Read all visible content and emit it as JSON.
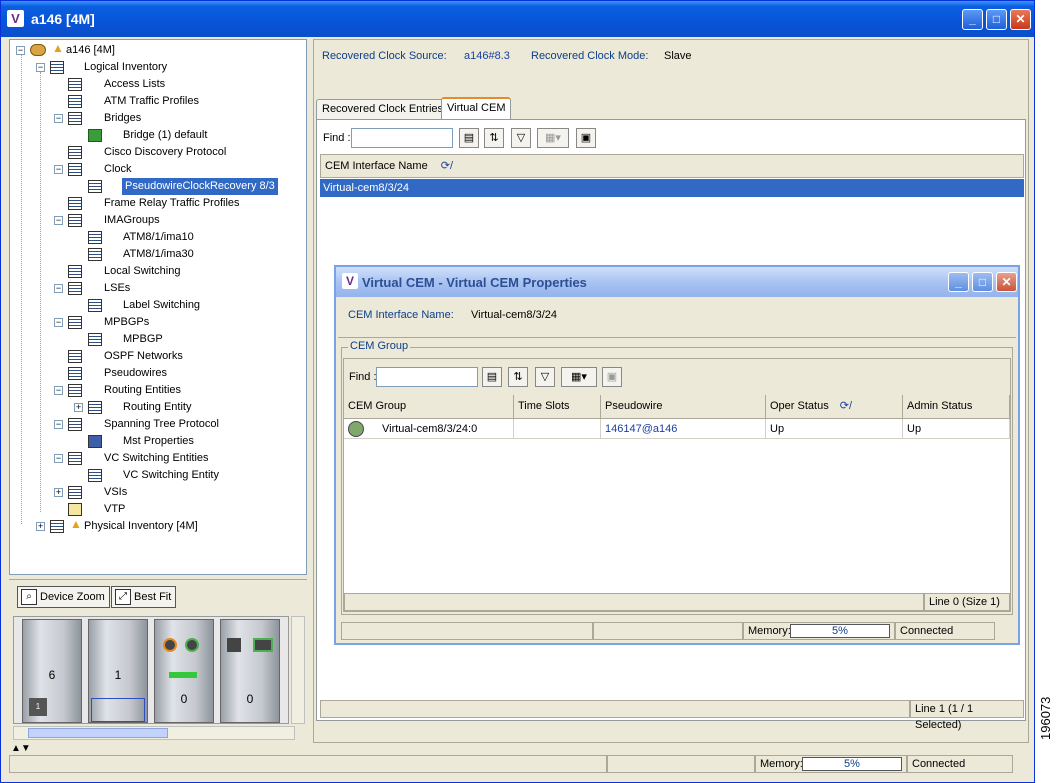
{
  "window": {
    "title": "a146 [4M]",
    "controls": {
      "minimize": "_",
      "maximize": "□",
      "close": "✕"
    }
  },
  "tree": {
    "root": "a146 [4M]",
    "items": [
      {
        "label": "Logical Inventory"
      },
      {
        "label": "Access Lists"
      },
      {
        "label": "ATM Traffic Profiles"
      },
      {
        "label": "Bridges"
      },
      {
        "label": "Bridge (1) default"
      },
      {
        "label": "Cisco Discovery Protocol"
      },
      {
        "label": "Clock"
      },
      {
        "label": "PseudowireClockRecovery 8/3"
      },
      {
        "label": "Frame Relay Traffic Profiles"
      },
      {
        "label": "IMAGroups"
      },
      {
        "label": "ATM8/1/ima10"
      },
      {
        "label": "ATM8/1/ima30"
      },
      {
        "label": "Local Switching"
      },
      {
        "label": "LSEs"
      },
      {
        "label": "Label Switching"
      },
      {
        "label": "MPBGPs"
      },
      {
        "label": "MPBGP"
      },
      {
        "label": "OSPF Networks"
      },
      {
        "label": "Pseudowires"
      },
      {
        "label": "Routing Entities"
      },
      {
        "label": "Routing Entity"
      },
      {
        "label": "Spanning Tree Protocol"
      },
      {
        "label": "Mst Properties"
      },
      {
        "label": "VC Switching Entities"
      },
      {
        "label": "VC Switching Entity"
      },
      {
        "label": "VSIs"
      },
      {
        "label": "VTP"
      },
      {
        "label": "Physical Inventory [4M]"
      }
    ]
  },
  "zoom": {
    "device_zoom": "Device Zoom",
    "best_fit": "Best Fit",
    "slots": [
      "6",
      "1",
      "0",
      "0"
    ],
    "small_slot": "1"
  },
  "properties": {
    "source_label": "Recovered Clock Source:",
    "source_value": "a146#8.3",
    "mode_label": "Recovered Clock Mode:",
    "mode_value": "Slave"
  },
  "tabs": [
    {
      "label": "Recovered Clock Entries"
    },
    {
      "label": "Virtual CEM"
    }
  ],
  "main_table": {
    "find_label": "Find :",
    "column": "CEM Interface Name",
    "rows": [
      "Virtual-cem8/3/24"
    ],
    "status": "Line 1 (1 / 1 Selected)"
  },
  "dialog": {
    "title": "Virtual CEM - Virtual CEM Properties",
    "cem_label": "CEM Interface Name:",
    "cem_value": "Virtual-cem8/3/24",
    "group_legend": "CEM Group",
    "find_label": "Find :",
    "columns": [
      "CEM Group",
      "Time Slots",
      "Pseudowire",
      "Oper Status",
      "Admin Status"
    ],
    "row": {
      "cem_group": "Virtual-cem8/3/24:0",
      "time_slots": "",
      "pseudowire": "146147@a146",
      "oper_status": "Up",
      "admin_status": "Up"
    },
    "line_status": "Line 0 (Size 1)",
    "memory_label": "Memory:",
    "memory_value": "5%",
    "connection": "Connected"
  },
  "statusbar": {
    "memory_label": "Memory:",
    "memory_value": "5%",
    "connection": "Connected"
  },
  "side_id": "196073",
  "colors": {
    "selection": "#316ac5",
    "title": "#0a5fe0",
    "label_blue": "#0c3e8a"
  }
}
